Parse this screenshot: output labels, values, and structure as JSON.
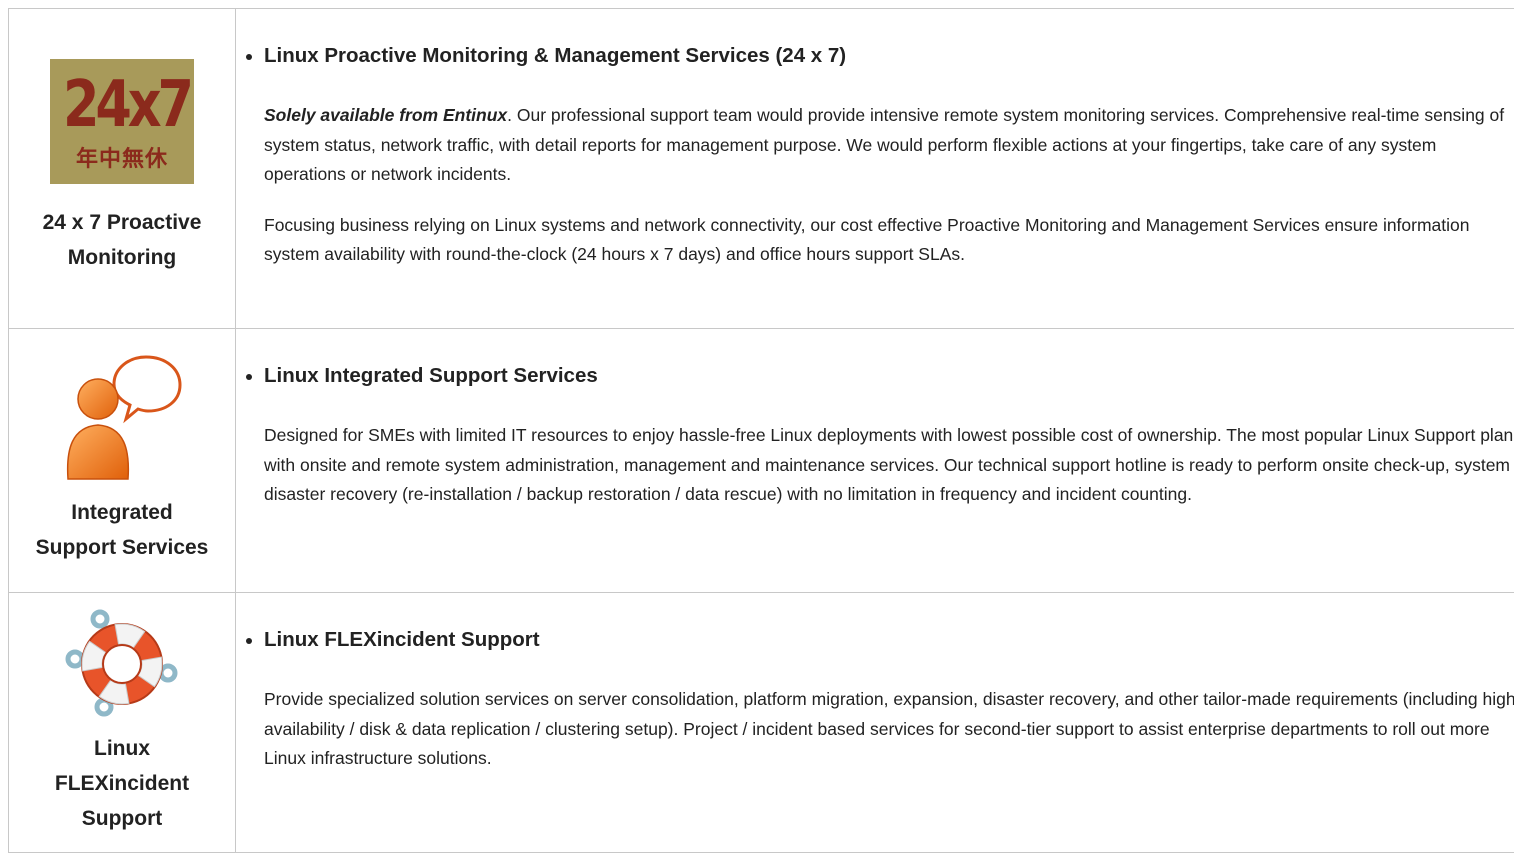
{
  "services": [
    {
      "icon": "24x7-badge-icon",
      "badge_big": "24x7",
      "badge_sub": "年中無休",
      "caption_line1": "24 x 7 Proactive",
      "caption_line2": "Monitoring",
      "title": "Linux Proactive Monitoring & Management Services (24 x 7)",
      "p1_lead": "Solely available from Entinux",
      "p1_rest": ". Our professional support team would provide intensive remote system monitoring services. Comprehensive real-time sensing of system status, network traffic, with detail reports for management purpose. We would perform flexible actions at your fingertips, take care of any system operations or network incidents.",
      "p2": "Focusing business relying on Linux systems and network connectivity, our cost effective Proactive Monitoring and Management Services ensure information system availability with round-the-clock (24 hours x 7 days) and office hours support SLAs."
    },
    {
      "icon": "support-person-speech-icon",
      "caption_line1": "Integrated",
      "caption_line2": "Support Services",
      "title": "Linux Integrated Support Services",
      "p1": "Designed for SMEs with limited IT resources to enjoy hassle-free Linux deployments with lowest possible cost of ownership. The most popular Linux Support plan with onsite and remote system administration, management and maintenance services. Our technical support hotline is ready to perform onsite check-up, system disaster recovery (re-installation / backup restoration / data rescue) with no limitation in frequency and incident counting."
    },
    {
      "icon": "lifebuoy-icon",
      "caption_line1": "Linux",
      "caption_line2": "FLEXincident",
      "caption_line3": "Support",
      "title": "Linux FLEXincident Support",
      "p1": "Provide specialized solution services on server consolidation, platform migration, expansion, disaster recovery, and other tailor-made requirements (including high availability / disk & data replication / clustering setup). Project / incident based services for second-tier support to assist enterprise departments to roll out more Linux infrastructure solutions."
    }
  ],
  "colors": {
    "badge_bg": "#a89a5a",
    "badge_text": "#8b2a1c",
    "person_orange": "#f07a1e",
    "lifebuoy_red": "#e8542a",
    "lifebuoy_blue": "#8fb8c8",
    "border": "#c8c8c8"
  }
}
